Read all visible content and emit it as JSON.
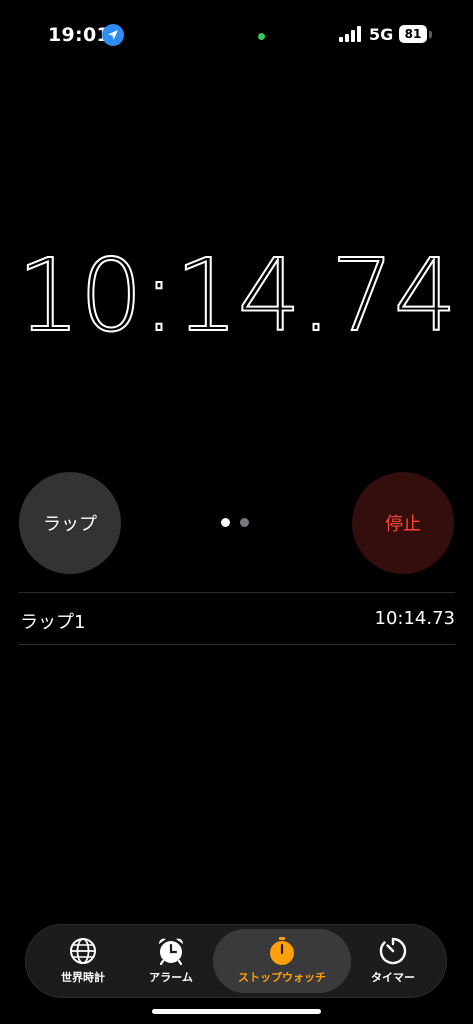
{
  "status_bar": {
    "time": "19:01",
    "network": "5G",
    "battery": "81",
    "location_icon": "location-arrow-icon",
    "signal_icon": "cellular-signal-icon"
  },
  "stopwatch": {
    "elapsed": "10:14.74",
    "lap_button_label": "ラップ",
    "stop_button_label": "停止",
    "stop_color": "#ff453a",
    "page_indicator": {
      "count": 2,
      "current": 1
    }
  },
  "laps": [
    {
      "label": "ラップ1",
      "time": "10:14.73"
    }
  ],
  "tab_bar": {
    "accent_color": "#ff9f0a",
    "tabs": [
      {
        "label": "世界時計",
        "icon": "globe-icon",
        "selected": false
      },
      {
        "label": "アラーム",
        "icon": "alarm-clock-icon",
        "selected": false
      },
      {
        "label": "ストップウォッチ",
        "icon": "stopwatch-icon",
        "selected": true
      },
      {
        "label": "タイマー",
        "icon": "timer-icon",
        "selected": false
      }
    ]
  }
}
